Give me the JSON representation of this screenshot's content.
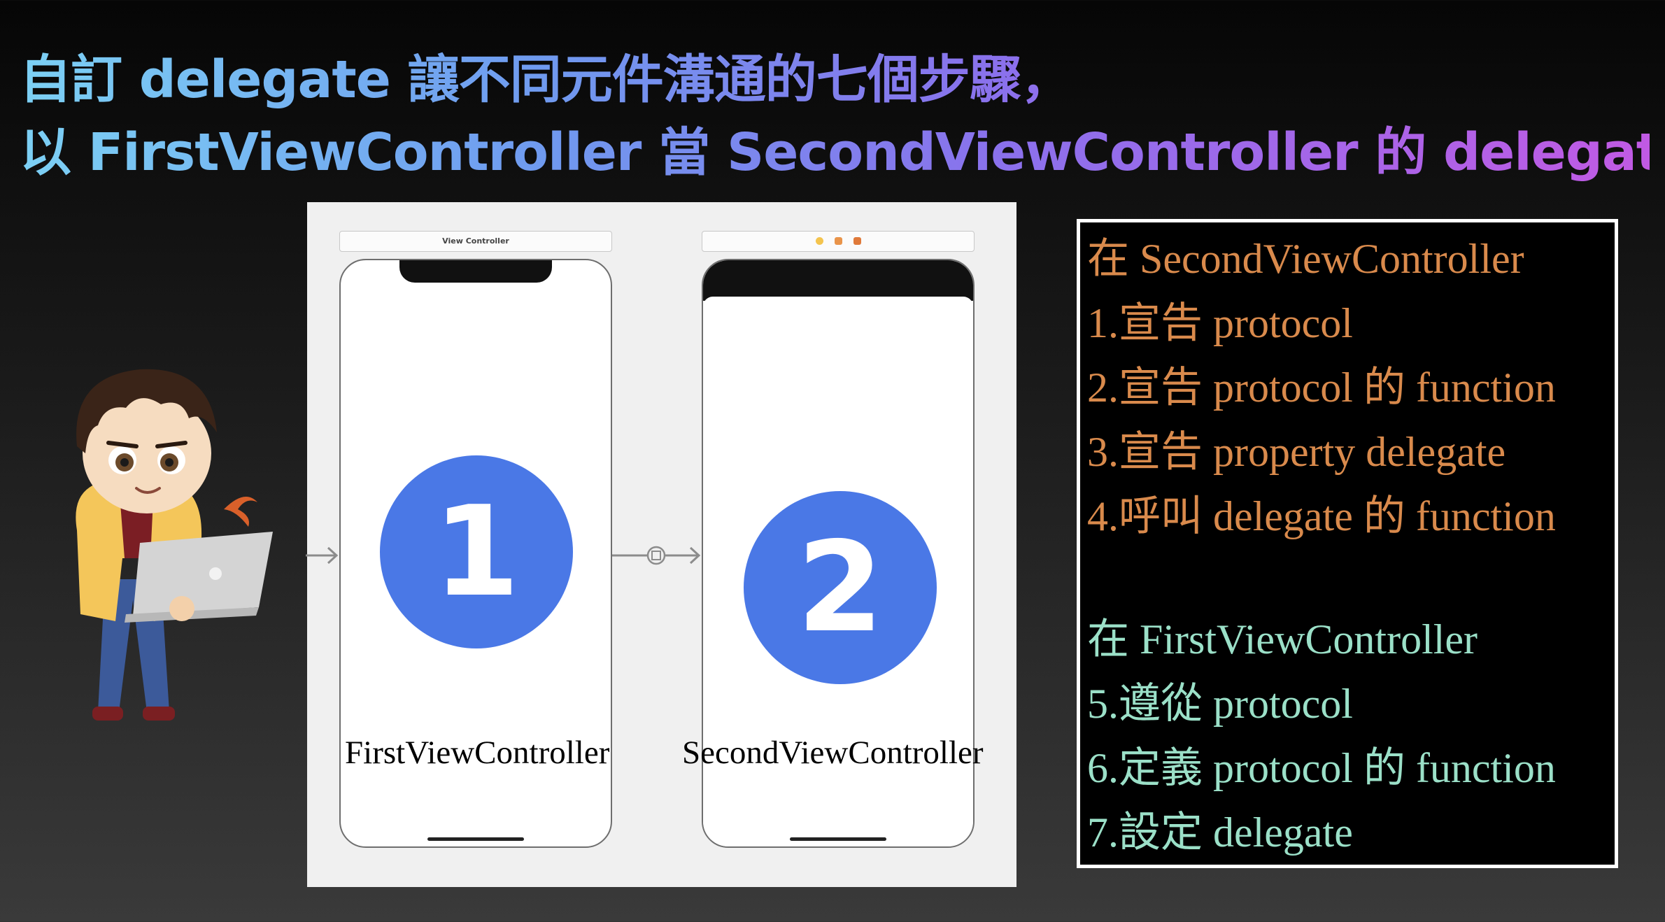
{
  "title": {
    "line1": "自訂 delegate 讓不同元件溝通的七個步驟，",
    "line2": "以 FirstViewController 當 SecondViewController 的 delegate 為例"
  },
  "storyboard": {
    "scene1": {
      "header": "View Controller",
      "number": "1",
      "label": "FirstViewController"
    },
    "scene2": {
      "number": "2",
      "label": "SecondViewController"
    },
    "colors": {
      "circle": "#4a78e6"
    }
  },
  "steps": {
    "second_heading": "在 SecondViewController",
    "second_steps": [
      "1.宣告 protocol",
      "2.宣告 protocol 的 function",
      "3.宣告 property delegate",
      "4.呼叫 delegate 的 function"
    ],
    "first_heading": "在 FirstViewController",
    "first_steps": [
      "5.遵從 protocol",
      "6.定義 protocol 的 function",
      "7.設定 delegate"
    ],
    "colors": {
      "second": "#d98a4c",
      "first": "#9be0c8"
    }
  }
}
